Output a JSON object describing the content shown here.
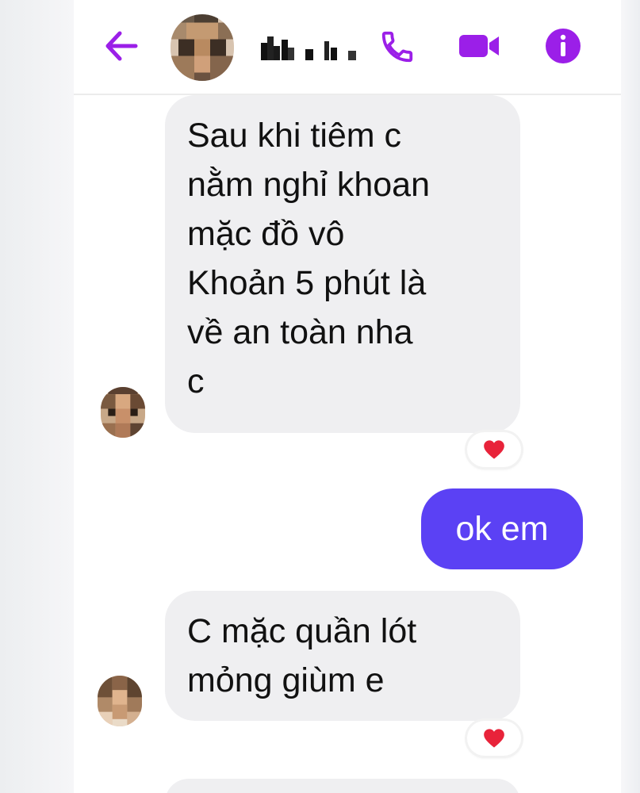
{
  "header": {
    "back_icon": "arrow-left-icon",
    "contact_name_redacted": true,
    "call_icon": "phone-icon",
    "video_icon": "video-camera-icon",
    "info_icon": "info-icon",
    "accent_color": "#9b1fe8"
  },
  "messages": [
    {
      "direction": "incoming",
      "lines": [
        "Sau khi tiêm c",
        "nằm nghỉ khoan",
        "mặc đồ vô",
        "Khoản 5 phút là",
        "về an toàn nha",
        "c"
      ],
      "reaction": "heart"
    },
    {
      "direction": "outgoing",
      "text": "ok em",
      "bubble_color": "#5b41f4"
    },
    {
      "direction": "incoming",
      "lines": [
        "C mặc quần lót",
        "mỏng giùm e"
      ],
      "reaction": "heart"
    }
  ],
  "reaction_color": "#e8233a"
}
